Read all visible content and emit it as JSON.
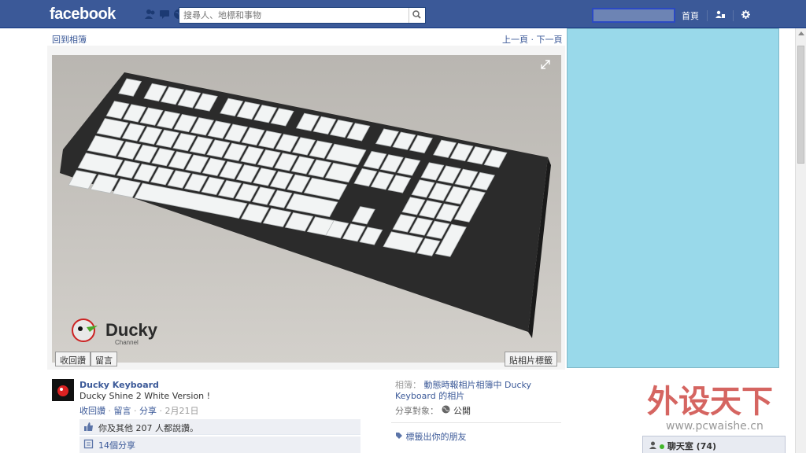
{
  "topbar": {
    "logo": "facebook",
    "search_placeholder": "搜尋人、地標和事物",
    "nav_home": "首頁"
  },
  "photo_viewer": {
    "back_to_album": "回到相簿",
    "pager": "上一頁 · 下一頁",
    "like_label": "收回讚",
    "comment_label": "留言",
    "tag_photo_label": "貼相片標籤",
    "brand_text": "Ducky",
    "brand_sub": "Channel"
  },
  "post": {
    "author": "Ducky Keyboard",
    "text": "Ducky Shine 2 White Version !",
    "actions": {
      "unlike": "收回讚",
      "comment": "留言",
      "share": "分享",
      "date": "2月21日"
    },
    "likes_text": "你及其他 207 人都說讚。",
    "shares_text": "14個分享"
  },
  "album": {
    "prefix": "相簿：",
    "name": "動態時報相片相簿中 Ducky Keyboard 的相片",
    "share_target_label": "分享對象：",
    "share_target_value": "公開",
    "tag_friends": "標籤出你的朋友"
  },
  "watermark": {
    "text": "外设天下",
    "url": "www.pcwaishe.cn"
  },
  "chat": {
    "label": "聊天室 (74)"
  },
  "colors": {
    "brand_blue": "#3b5998",
    "ad_pane": "#99d9ea",
    "watermark_red": "#c8322d"
  }
}
